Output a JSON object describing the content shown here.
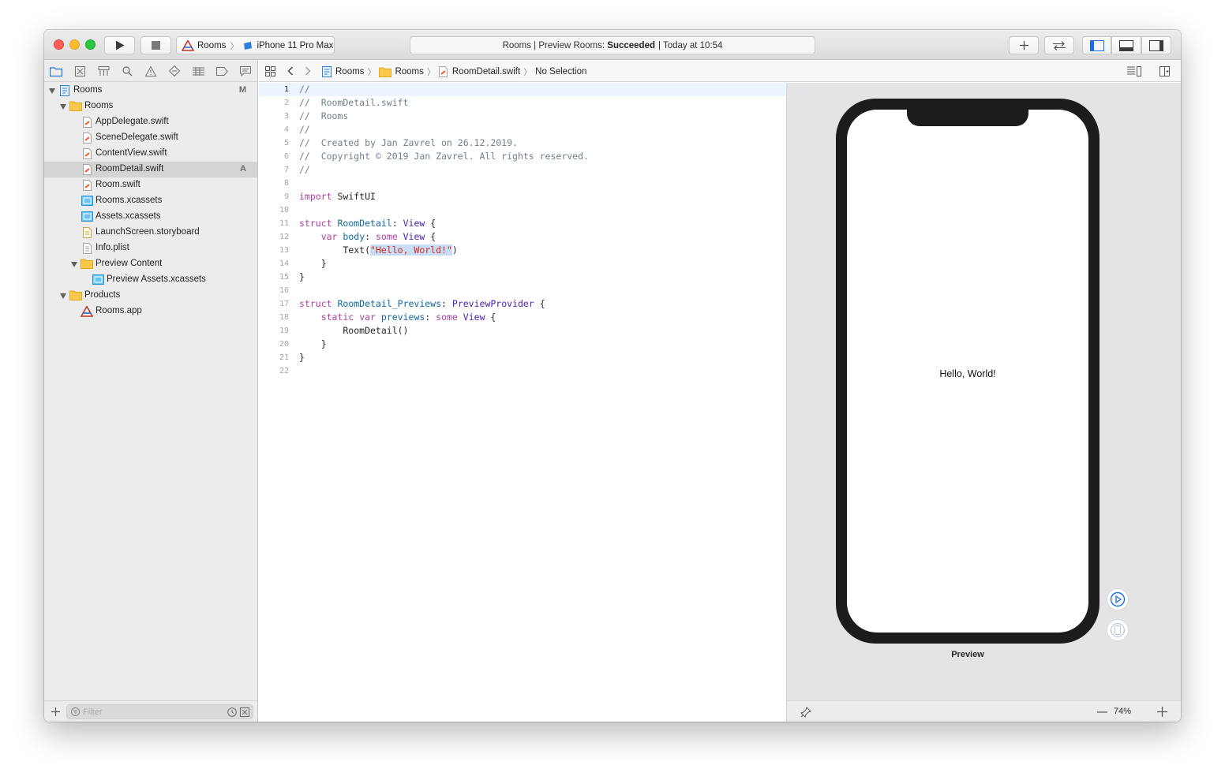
{
  "toolbar": {
    "scheme_target": "Rooms",
    "scheme_device": "iPhone 11 Pro Max",
    "activity_prefix": "Rooms | Preview Rooms: ",
    "activity_status": "Succeeded",
    "activity_time": "| Today at 10:54"
  },
  "navigator": {
    "filter_placeholder": "Filter",
    "items": [
      {
        "label": "Rooms",
        "status": "M"
      },
      {
        "label": "Rooms"
      },
      {
        "label": "AppDelegate.swift"
      },
      {
        "label": "SceneDelegate.swift"
      },
      {
        "label": "ContentView.swift"
      },
      {
        "label": "RoomDetail.swift",
        "status": "A"
      },
      {
        "label": "Room.swift"
      },
      {
        "label": "Rooms.xcassets"
      },
      {
        "label": "Assets.xcassets"
      },
      {
        "label": "LaunchScreen.storyboard"
      },
      {
        "label": "Info.plist"
      },
      {
        "label": "Preview Content"
      },
      {
        "label": "Preview Assets.xcassets"
      },
      {
        "label": "Products"
      },
      {
        "label": "Rooms.app"
      }
    ]
  },
  "jumpbar": {
    "project": "Rooms",
    "group": "Rooms",
    "file": "RoomDetail.swift",
    "selection": "No Selection"
  },
  "editor": {
    "current_line": 1,
    "lines": [
      {
        "n": "1",
        "text": "//"
      },
      {
        "n": "2",
        "text": "//  RoomDetail.swift"
      },
      {
        "n": "3",
        "text": "//  Rooms"
      },
      {
        "n": "4",
        "text": "//"
      },
      {
        "n": "5",
        "text": "//  Created by Jan Zavrel on 26.12.2019."
      },
      {
        "n": "6",
        "text": "//  Copyright © 2019 Jan Zavrel. All rights reserved."
      },
      {
        "n": "7",
        "text": "//"
      },
      {
        "n": "8",
        "text": ""
      },
      {
        "n": "9",
        "text": "import SwiftUI"
      },
      {
        "n": "10",
        "text": ""
      },
      {
        "n": "11",
        "text": "struct RoomDetail: View {"
      },
      {
        "n": "12",
        "text": "    var body: some View {"
      },
      {
        "n": "13",
        "text": "        Text(\"Hello, World!\")"
      },
      {
        "n": "14",
        "text": "    }"
      },
      {
        "n": "15",
        "text": "}"
      },
      {
        "n": "16",
        "text": ""
      },
      {
        "n": "17",
        "text": "struct RoomDetail_Previews: PreviewProvider {"
      },
      {
        "n": "18",
        "text": "    static var previews: some View {"
      },
      {
        "n": "19",
        "text": "        RoomDetail()"
      },
      {
        "n": "20",
        "text": "    }"
      },
      {
        "n": "21",
        "text": "}"
      },
      {
        "n": "22",
        "text": ""
      }
    ]
  },
  "canvas": {
    "preview_text": "Hello, World!",
    "preview_label": "Preview",
    "zoom": "74%"
  },
  "colors": {
    "accent": "#1a6fe0",
    "selection": "#d4d4d4",
    "keyword": "#ad3da4",
    "string": "#d12f1b",
    "comment": "#707f8c"
  }
}
